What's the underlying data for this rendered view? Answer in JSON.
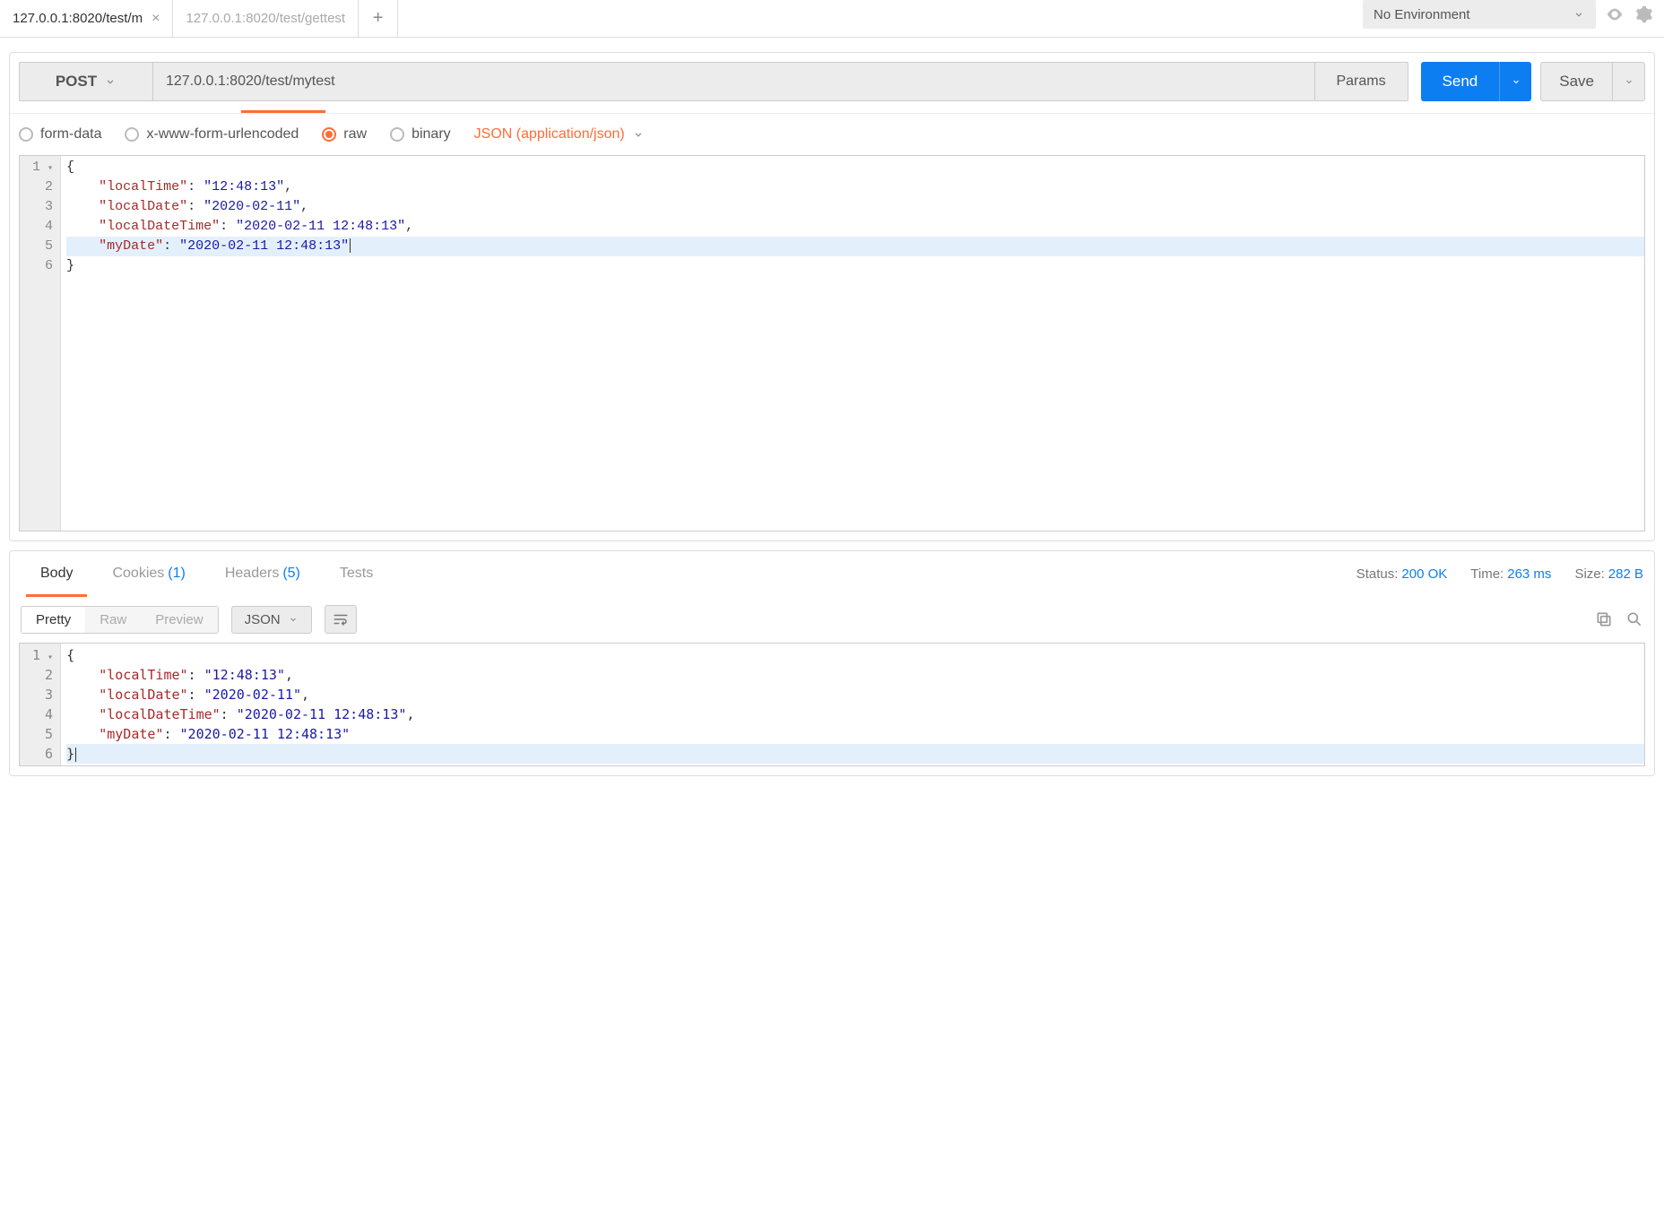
{
  "tabs": [
    {
      "label": "127.0.0.1:8020/test/m",
      "active": true
    },
    {
      "label": "127.0.0.1:8020/test/gettest",
      "active": false
    }
  ],
  "environment": {
    "selected": "No Environment"
  },
  "request": {
    "method": "POST",
    "url": "127.0.0.1:8020/test/mytest",
    "params_btn": "Params",
    "send_btn": "Send",
    "save_btn": "Save"
  },
  "body_types": {
    "form_data": "form-data",
    "urlencoded": "x-www-form-urlencoded",
    "raw": "raw",
    "binary": "binary",
    "content_type": "JSON (application/json)"
  },
  "request_body_lines": [
    {
      "n": "1",
      "fold": true,
      "tokens": [
        {
          "t": "punc",
          "v": "{"
        }
      ]
    },
    {
      "n": "2",
      "tokens": [
        {
          "t": "ind",
          "v": "    "
        },
        {
          "t": "key",
          "v": "\"localTime\""
        },
        {
          "t": "punc",
          "v": ": "
        },
        {
          "t": "str",
          "v": "\"12:48:13\""
        },
        {
          "t": "punc",
          "v": ","
        }
      ]
    },
    {
      "n": "3",
      "tokens": [
        {
          "t": "ind",
          "v": "    "
        },
        {
          "t": "key",
          "v": "\"localDate\""
        },
        {
          "t": "punc",
          "v": ": "
        },
        {
          "t": "str",
          "v": "\"2020-02-11\""
        },
        {
          "t": "punc",
          "v": ","
        }
      ]
    },
    {
      "n": "4",
      "tokens": [
        {
          "t": "ind",
          "v": "    "
        },
        {
          "t": "key",
          "v": "\"localDateTime\""
        },
        {
          "t": "punc",
          "v": ": "
        },
        {
          "t": "str",
          "v": "\"2020-02-11 12:48:13\""
        },
        {
          "t": "punc",
          "v": ","
        }
      ]
    },
    {
      "n": "5",
      "hl": true,
      "cursor_after": true,
      "tokens": [
        {
          "t": "ind",
          "v": "    "
        },
        {
          "t": "key",
          "v": "\"myDate\""
        },
        {
          "t": "punc",
          "v": ": "
        },
        {
          "t": "str",
          "v": "\"2020-02-11 12:48:13\""
        }
      ]
    },
    {
      "n": "6",
      "tokens": [
        {
          "t": "punc",
          "v": "}"
        }
      ]
    }
  ],
  "response_tabs": {
    "body": "Body",
    "cookies": "Cookies",
    "cookies_count": "(1)",
    "headers": "Headers",
    "headers_count": "(5)",
    "tests": "Tests"
  },
  "response_meta": {
    "status_label": "Status:",
    "status_value": "200 OK",
    "time_label": "Time:",
    "time_value": "263 ms",
    "size_label": "Size:",
    "size_value": "282 B"
  },
  "response_views": {
    "pretty": "Pretty",
    "raw": "Raw",
    "preview": "Preview",
    "format": "JSON"
  },
  "response_body_lines": [
    {
      "n": "1",
      "fold": true,
      "tokens": [
        {
          "t": "punc",
          "v": "{"
        }
      ]
    },
    {
      "n": "2",
      "tokens": [
        {
          "t": "ind",
          "v": "    "
        },
        {
          "t": "key",
          "v": "\"localTime\""
        },
        {
          "t": "punc",
          "v": ": "
        },
        {
          "t": "str",
          "v": "\"12:48:13\""
        },
        {
          "t": "punc",
          "v": ","
        }
      ]
    },
    {
      "n": "3",
      "tokens": [
        {
          "t": "ind",
          "v": "    "
        },
        {
          "t": "key",
          "v": "\"localDate\""
        },
        {
          "t": "punc",
          "v": ": "
        },
        {
          "t": "str",
          "v": "\"2020-02-11\""
        },
        {
          "t": "punc",
          "v": ","
        }
      ]
    },
    {
      "n": "4",
      "tokens": [
        {
          "t": "ind",
          "v": "    "
        },
        {
          "t": "key",
          "v": "\"localDateTime\""
        },
        {
          "t": "punc",
          "v": ": "
        },
        {
          "t": "str",
          "v": "\"2020-02-11 12:48:13\""
        },
        {
          "t": "punc",
          "v": ","
        }
      ]
    },
    {
      "n": "5",
      "tokens": [
        {
          "t": "ind",
          "v": "    "
        },
        {
          "t": "key",
          "v": "\"myDate\""
        },
        {
          "t": "punc",
          "v": ": "
        },
        {
          "t": "str",
          "v": "\"2020-02-11 12:48:13\""
        }
      ]
    },
    {
      "n": "6",
      "hl": true,
      "cursor_after": true,
      "tokens": [
        {
          "t": "punc",
          "v": "}"
        }
      ]
    }
  ]
}
